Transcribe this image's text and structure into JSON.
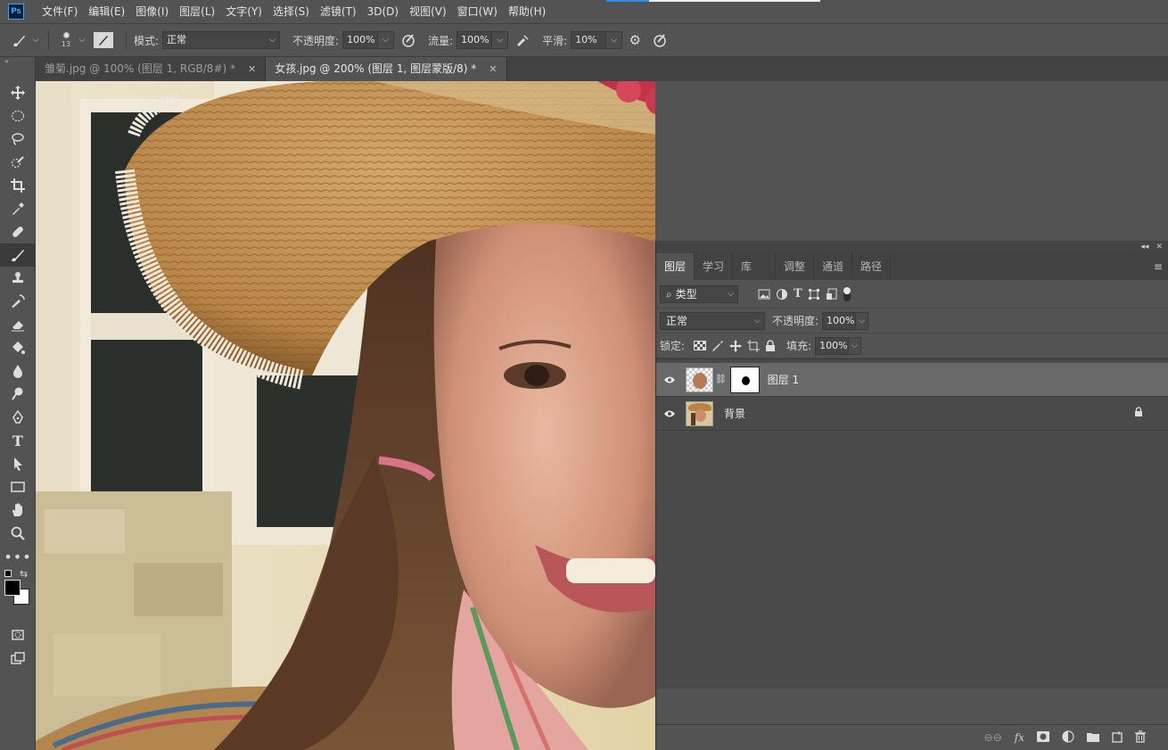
{
  "menubar": {
    "logo": "Ps",
    "items": [
      "文件(F)",
      "编辑(E)",
      "图像(I)",
      "图层(L)",
      "文字(Y)",
      "选择(S)",
      "滤镜(T)",
      "3D(D)",
      "视图(V)",
      "窗口(W)",
      "帮助(H)"
    ]
  },
  "options": {
    "brush_size": "13",
    "mode_label": "模式:",
    "mode_value": "正常",
    "opacity_label": "不透明度:",
    "opacity_value": "100%",
    "flow_label": "流量:",
    "flow_value": "100%",
    "smooth_label": "平滑:",
    "smooth_value": "10%"
  },
  "tabs": [
    {
      "label": "雏菊.jpg @ 100% (图层 1, RGB/8#) *",
      "active": false
    },
    {
      "label": "女孩.jpg @ 200% (图层 1, 图层蒙版/8) *",
      "active": true
    }
  ],
  "tools": [
    "move-tool",
    "marquee-tool",
    "lasso-tool",
    "quick-select-tool",
    "crop-tool",
    "eyedropper-tool",
    "healing-tool",
    "brush-tool",
    "stamp-tool",
    "history-brush-tool",
    "eraser-tool",
    "paint-bucket-tool",
    "blur-tool",
    "dodge-tool",
    "pen-tool",
    "type-tool",
    "path-select-tool",
    "rectangle-tool",
    "hand-tool",
    "zoom-tool",
    "more-tools"
  ],
  "active_tool": "brush-tool",
  "colors": {
    "foreground": "#000000",
    "background": "#ffffff",
    "accent": "#31a8ff"
  },
  "layers_panel": {
    "tabs": [
      "图层",
      "学习",
      "库",
      "调整",
      "通道",
      "路径"
    ],
    "filter_kind": "类型",
    "blend_mode": "正常",
    "opacity_label": "不透明度:",
    "opacity_value": "100%",
    "lock_label": "锁定:",
    "fill_label": "填充:",
    "fill_value": "100%",
    "layers": [
      {
        "name": "图层 1",
        "visible": true,
        "selected": true,
        "has_mask": true
      },
      {
        "name": "背景",
        "visible": true,
        "selected": false,
        "locked": true
      }
    ]
  }
}
